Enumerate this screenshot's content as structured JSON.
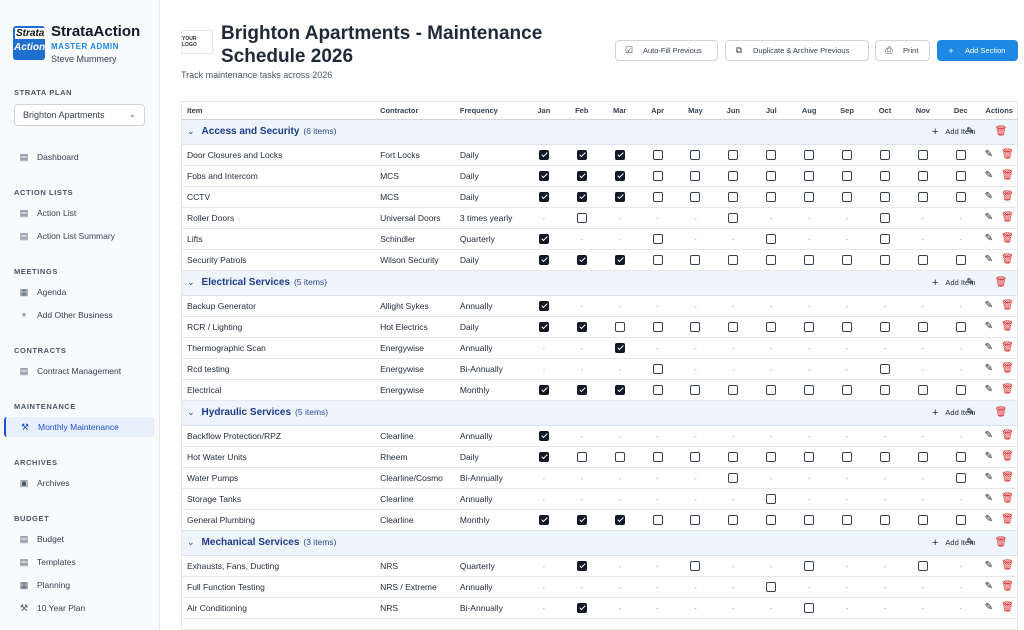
{
  "app": {
    "name": "StrataAction",
    "role": "MASTER ADMIN",
    "user": "Steve Mummery",
    "logo_top": "Strata",
    "logo_bottom": "Action"
  },
  "sidebar": {
    "plan_label": "STRATA PLAN",
    "plan_value": "Brighton Apartments",
    "dashboard": "Dashboard",
    "groups": [
      {
        "label": "ACTION LISTS",
        "items": [
          "Action List",
          "Action List Summary"
        ]
      },
      {
        "label": "MEETINGS",
        "items": [
          "Agenda",
          "Add Other Business"
        ]
      },
      {
        "label": "CONTRACTS",
        "items": [
          "Contract Management"
        ]
      },
      {
        "label": "MAINTENANCE",
        "items": [
          "Monthly Maintenance"
        ]
      },
      {
        "label": "ARCHIVES",
        "items": [
          "Archives"
        ]
      },
      {
        "label": "BUDGET",
        "items": [
          "Budget",
          "Templates",
          "Planning",
          "10 Year Plan"
        ]
      }
    ]
  },
  "header": {
    "logo_text": "YOUR LOGO",
    "title": "Brighton Apartments - Maintenance Schedule 2026",
    "subtitle": "Track maintenance tasks across 2026",
    "buttons": {
      "autofill": "Auto-Fill Previous",
      "duplicate": "Duplicate & Archive Previous",
      "print": "Print",
      "add_section": "Add Section"
    }
  },
  "table": {
    "columns": [
      "Item",
      "Contractor",
      "Frequency",
      "Jan",
      "Feb",
      "Mar",
      "Apr",
      "May",
      "Jun",
      "Jul",
      "Aug",
      "Sep",
      "Oct",
      "Nov",
      "Dec",
      "Actions"
    ],
    "add_item_label": "Add Item",
    "sections": [
      {
        "title": "Access and Security",
        "count": "(6 items)",
        "items": [
          {
            "name": "Door Closures and Locks",
            "contractor": "Fort Locks",
            "frequency": "Daily",
            "months": "111000000000"
          },
          {
            "name": "Fobs and Intercom",
            "contractor": "MCS",
            "frequency": "Daily",
            "months": "111000000000"
          },
          {
            "name": "CCTV",
            "contractor": "MCS",
            "frequency": "Daily",
            "months": "111000000000"
          },
          {
            "name": "Roller Doors",
            "contractor": "Universal Doors",
            "frequency": "3 times yearly",
            "months": "-0---0---0--"
          },
          {
            "name": "Lifts",
            "contractor": "Schindler",
            "frequency": "Quarterly",
            "months": "1--0--0--0--"
          },
          {
            "name": "Security Patrols",
            "contractor": "Wilson Security",
            "frequency": "Daily",
            "months": "111000000000"
          }
        ]
      },
      {
        "title": "Electrical Services",
        "count": "(5 items)",
        "items": [
          {
            "name": "Backup Generator",
            "contractor": "Allight Sykes",
            "frequency": "Annually",
            "months": "1-----------"
          },
          {
            "name": "RCR / Lighting",
            "contractor": "Hot Electrics",
            "frequency": "Daily",
            "months": "110000000000"
          },
          {
            "name": "Thermographic Scan",
            "contractor": "Energywise",
            "frequency": "Annually",
            "months": "--1---------"
          },
          {
            "name": "Rcd testing",
            "contractor": "Energywise",
            "frequency": "Bi-Annually",
            "months": "---0-----0--"
          },
          {
            "name": "Electrical",
            "contractor": "Energywise",
            "frequency": "Monthly",
            "months": "111000000000"
          }
        ]
      },
      {
        "title": "Hydraulic Services",
        "count": "(5 items)",
        "items": [
          {
            "name": "Backflow Protection/RPZ",
            "contractor": "Clearline",
            "frequency": "Annually",
            "months": "1-----------"
          },
          {
            "name": "Hot Water Units",
            "contractor": "Rheem",
            "frequency": "Daily",
            "months": "100000000000"
          },
          {
            "name": "Water Pumps",
            "contractor": "Clearline/Cosmo",
            "frequency": "Bi-Annually",
            "months": "-----0-----0"
          },
          {
            "name": "Storage Tanks",
            "contractor": "Clearline",
            "frequency": "Annually",
            "months": "------0-----"
          },
          {
            "name": "General Plumbing",
            "contractor": "Clearline",
            "frequency": "Monthly",
            "months": "111000000000"
          }
        ]
      },
      {
        "title": "Mechanical Services",
        "count": "(3 items)",
        "items": [
          {
            "name": "Exhausts, Fans, Ducting",
            "contractor": "NRS",
            "frequency": "Quarterly",
            "months": "-1--0--0--0-"
          },
          {
            "name": "Full Function Testing",
            "contractor": "NRS / Extreme",
            "frequency": "Annually",
            "months": "------0-----"
          },
          {
            "name": "Air Conditioning",
            "contractor": "NRS",
            "frequency": "Bi-Annually",
            "months": "-1-----0----"
          }
        ]
      }
    ]
  },
  "icons": {
    "edit": "edit-icon",
    "delete": "trash-icon",
    "chevron": "chevron-down-icon"
  },
  "colors": {
    "accent": "#1e88e5",
    "section_bg": "#eef4fb",
    "section_text": "#1e3a8a",
    "delete": "#dc2626",
    "active_nav": "#1d4ed8"
  }
}
